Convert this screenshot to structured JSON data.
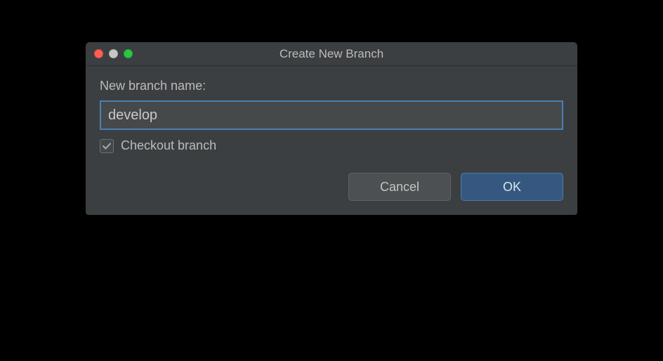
{
  "dialog": {
    "title": "Create New Branch",
    "branch_name_label": "New branch name:",
    "branch_name_value": "develop",
    "checkout_checkbox_label": "Checkout branch",
    "checkout_checked": true,
    "buttons": {
      "cancel": "Cancel",
      "ok": "OK"
    }
  }
}
